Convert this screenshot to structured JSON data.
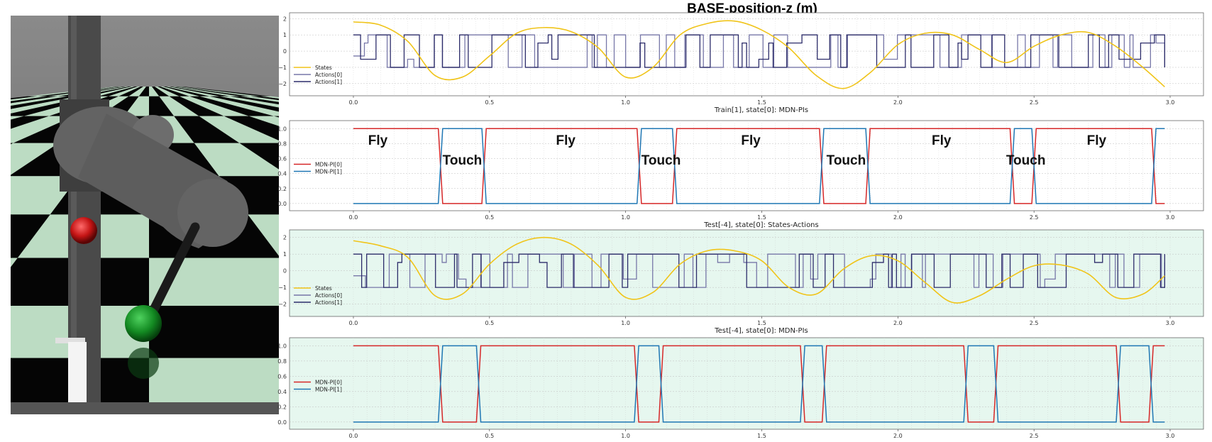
{
  "title": "BASE-position-z (m)",
  "colors": {
    "state": "#f0c419",
    "action0": "#7777a8",
    "action1": "#2c2c6a",
    "pi0": "#d62728",
    "pi1": "#1f77b4",
    "train_bg": "#ffffff",
    "test_bg": "#e6f7ef",
    "ball_red": "#cc1111",
    "foot_green": "#1d8a2a",
    "marker": "#2b4f8c"
  },
  "scene": {
    "description_icons": [
      "robot-arm",
      "red-ball",
      "green-foot",
      "checkerboard-floor"
    ]
  },
  "chart_data": [
    {
      "id": "train-states-actions",
      "type": "line",
      "title": "",
      "caption": "Train[1], state[0]: MDN-PIs",
      "background": "white",
      "xlim": [
        0,
        3.0
      ],
      "ylim": [
        -2.4,
        2.1
      ],
      "x_ticks": [
        "0.0",
        "0.5",
        "1.0",
        "1.5",
        "2.0",
        "2.5",
        "3.0"
      ],
      "y_ticks": [
        "2",
        "1",
        "0",
        "−1",
        "−2"
      ],
      "legend": [
        "States",
        "Actions[0]",
        "Actions[1]"
      ],
      "legend_position": "lower-left",
      "series": [
        {
          "name": "States",
          "x": [
            0.0,
            0.1,
            0.2,
            0.3,
            0.4,
            0.5,
            0.6,
            0.7,
            0.8,
            0.9,
            1.0,
            1.1,
            1.2,
            1.3,
            1.4,
            1.5,
            1.6,
            1.7,
            1.8,
            1.9,
            2.0,
            2.1,
            2.2,
            2.3,
            2.4,
            2.5,
            2.6,
            2.7,
            2.8,
            2.9,
            2.98
          ],
          "y": [
            1.8,
            1.6,
            0.6,
            -1.5,
            -1.6,
            -0.3,
            1.1,
            1.45,
            1.2,
            0.2,
            -1.6,
            -1.0,
            1.0,
            1.7,
            1.85,
            1.3,
            0.2,
            -1.5,
            -2.3,
            -1.3,
            0.4,
            1.1,
            1.0,
            0.1,
            -0.7,
            0.3,
            1.0,
            1.15,
            0.3,
            -1.0,
            -2.2
          ]
        }
      ]
    },
    {
      "id": "train-mdn-pis",
      "type": "line",
      "caption": "Test[-4], state[0]: States-Actions",
      "background": "white",
      "xlim": [
        0,
        3.0
      ],
      "ylim": [
        -0.02,
        1.05
      ],
      "x_ticks": [
        "0.0",
        "0.5",
        "1.0",
        "1.5",
        "2.0",
        "2.5",
        "3.0"
      ],
      "y_ticks": [
        "1.0",
        "0.8",
        "0.6",
        "0.4",
        "0.2",
        "0.0"
      ],
      "legend": [
        "MDN-PI[0]",
        "MDN-PI[1]"
      ],
      "legend_position": "center-left",
      "switch_times": [
        0.32,
        0.48,
        1.05,
        1.18,
        1.72,
        1.89,
        2.42,
        2.5,
        2.94
      ],
      "phases": [
        {
          "label": "Fly",
          "x": 0.09
        },
        {
          "label": "Touch",
          "x": 0.4
        },
        {
          "label": "Fly",
          "x": 0.78
        },
        {
          "label": "Touch",
          "x": 1.13
        },
        {
          "label": "Fly",
          "x": 1.46
        },
        {
          "label": "Touch",
          "x": 1.81
        },
        {
          "label": "Fly",
          "x": 2.16
        },
        {
          "label": "Touch",
          "x": 2.47
        },
        {
          "label": "Fly",
          "x": 2.73
        }
      ]
    },
    {
      "id": "test-states-actions",
      "type": "line",
      "caption": "Test[-4], state[0]: MDN-PIs",
      "background": "mint",
      "xlim": [
        0,
        3.0
      ],
      "ylim": [
        -2.4,
        2.2
      ],
      "x_ticks": [
        "0.0",
        "0.5",
        "1.0",
        "1.5",
        "2.0",
        "2.5",
        "3.0"
      ],
      "y_ticks": [
        "2",
        "1",
        "0",
        "−1",
        "−2"
      ],
      "legend": [
        "States",
        "Actions[0]",
        "Actions[1]"
      ],
      "legend_position": "lower-left",
      "series": [
        {
          "name": "States",
          "x": [
            0.0,
            0.1,
            0.2,
            0.3,
            0.4,
            0.5,
            0.6,
            0.7,
            0.8,
            0.9,
            1.0,
            1.1,
            1.2,
            1.3,
            1.4,
            1.5,
            1.6,
            1.7,
            1.8,
            1.9,
            2.0,
            2.1,
            2.2,
            2.3,
            2.4,
            2.5,
            2.6,
            2.7,
            2.8,
            2.9,
            2.98
          ],
          "y": [
            1.8,
            1.5,
            0.8,
            -1.5,
            -1.4,
            0.4,
            1.6,
            2.0,
            1.6,
            0.3,
            -1.6,
            -1.3,
            0.4,
            1.2,
            1.2,
            0.6,
            -1.0,
            -1.4,
            0.1,
            0.9,
            0.6,
            -0.7,
            -1.9,
            -1.5,
            -0.5,
            0.3,
            0.35,
            -0.2,
            -1.6,
            -1.4,
            -0.3
          ]
        }
      ]
    },
    {
      "id": "test-mdn-pis",
      "type": "line",
      "caption": "",
      "background": "mint",
      "xlim": [
        0,
        3.0
      ],
      "ylim": [
        -0.02,
        1.05
      ],
      "x_ticks": [
        "0.0",
        "0.5",
        "1.0",
        "1.5",
        "2.0",
        "2.5",
        "3.0"
      ],
      "y_ticks": [
        "1.0",
        "0.8",
        "0.6",
        "0.4",
        "0.2",
        "0.0"
      ],
      "legend": [
        "MDN-PI[0]",
        "MDN-PI[1]"
      ],
      "legend_position": "center-left",
      "switch_times": [
        0.32,
        0.46,
        1.04,
        1.13,
        1.65,
        1.73,
        2.25,
        2.36,
        2.81,
        2.93
      ]
    }
  ]
}
